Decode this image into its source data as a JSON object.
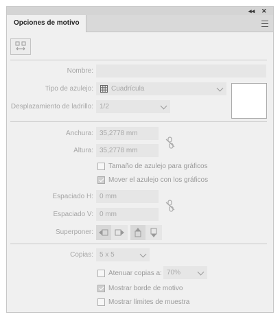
{
  "window": {
    "collapse_glyph": "◂◂",
    "close_glyph": "✕"
  },
  "tab": {
    "label": "Opciones de motivo"
  },
  "icons": {
    "tile_tool": "tile-edit-icon",
    "menu": "hamburger-menu-icon",
    "grid": "grid-icon",
    "link": "chain-link-icon"
  },
  "form": {
    "name_label": "Nombre:",
    "name_value": "",
    "tile_type_label": "Tipo de azulejo:",
    "tile_type_value": "Cuadrícula",
    "brick_offset_label": "Desplazamiento de ladrillo:",
    "brick_offset_value": "1/2",
    "width_label": "Anchura:",
    "width_value": "35,2778 mm",
    "height_label": "Altura:",
    "height_value": "35,2778 mm",
    "size_tile_to_art": {
      "label": "Tamaño de azulejo para gráficos",
      "checked": false
    },
    "move_tile_with_art": {
      "label": "Mover el azulejo con los gráficos",
      "checked": true
    },
    "h_spacing_label": "Espaciado H:",
    "h_spacing_value": "0 mm",
    "v_spacing_label": "Espaciado V:",
    "v_spacing_value": "0 mm",
    "overlap_label": "Superponer:",
    "copies_label": "Copias:",
    "copies_value": "5 x 5",
    "dim_copies": {
      "label": "Atenuar copias a:",
      "checked": false,
      "value": "70%"
    },
    "show_tile_edge": {
      "label": "Mostrar borde de motivo",
      "checked": true
    },
    "show_swatch_bounds": {
      "label": "Mostrar límites de muestra",
      "checked": false
    }
  },
  "colors": {
    "panel_bg": "#f0f0f0",
    "field_bg": "#e6e6e6",
    "label": "#a6a6a6"
  }
}
